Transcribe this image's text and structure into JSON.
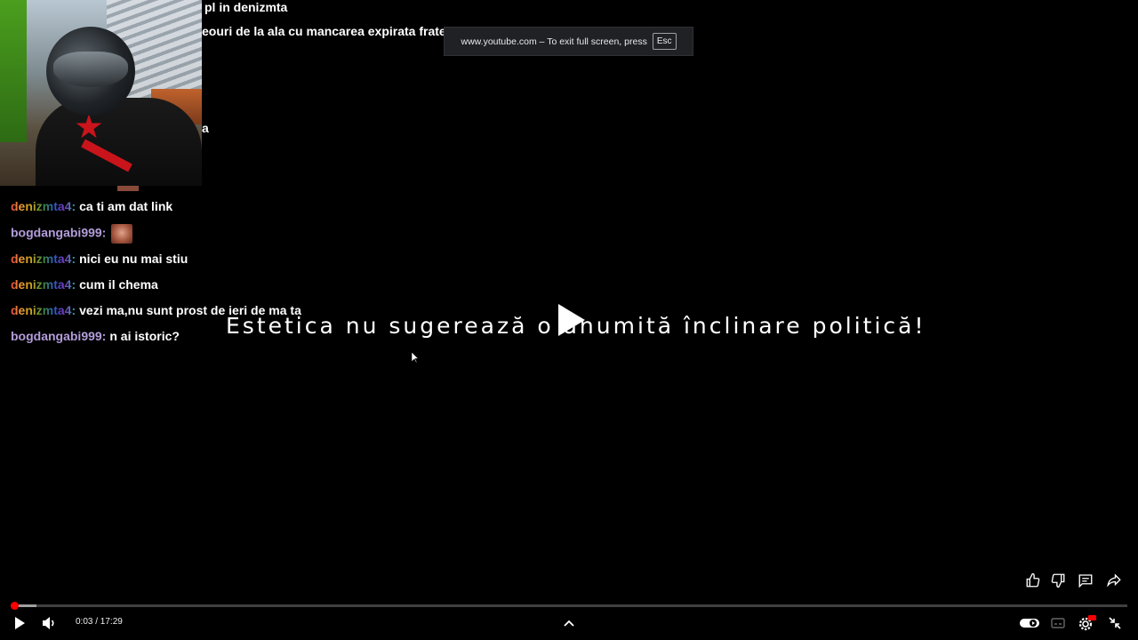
{
  "fullscreen_notice": {
    "text": "www.youtube.com – To exit full screen, press",
    "key": "Esc"
  },
  "chat": {
    "top_lines": [
      "pl in denizmta",
      "eouri de la ala cu mancarea expirata frate",
      "a"
    ],
    "messages": [
      {
        "user": "denizmta4:",
        "text": "ca ti am dat link"
      },
      {
        "user": "bogdangabi999:",
        "text": ""
      },
      {
        "user": "denizmta4:",
        "text": "nici eu nu mai stiu"
      },
      {
        "user": "denizmta4:",
        "text": "cum il chema"
      },
      {
        "user": "denizmta4:",
        "text": "vezi ma,nu sunt prost de ieri de ma ta"
      },
      {
        "user": "bogdangabi999:",
        "text": "n ai istoric?"
      }
    ]
  },
  "caption": "Estetica nu sugerează o anumită înclinare politică!",
  "player": {
    "time_display": "0:03 / 17:29",
    "progress_fraction": 0.0029,
    "buffered_fraction": 0.023,
    "accent_color": "#ff0000"
  },
  "icons": {
    "play": "play-icon",
    "volume": "volume-icon",
    "chevron": "chevron-up-icon",
    "autoplay": "autoplay-toggle-icon",
    "subtitles": "subtitles-icon",
    "settings": "settings-icon",
    "exit_fullscreen": "exit-fullscreen-icon",
    "like": "thumbs-up-icon",
    "dislike": "thumbs-down-icon",
    "comments": "comments-icon",
    "share": "share-icon"
  }
}
